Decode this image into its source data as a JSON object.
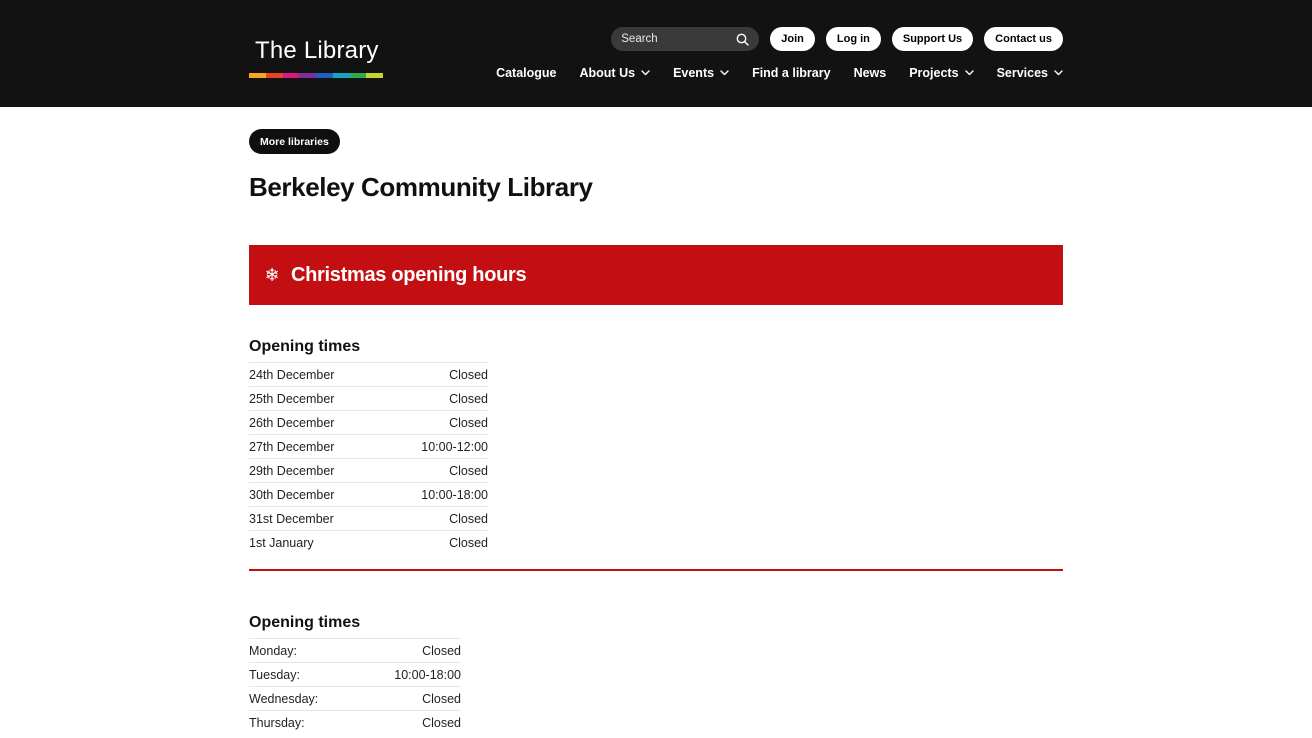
{
  "header": {
    "logo_text": "The Library",
    "logo_colors": [
      "#f5a623",
      "#e8441f",
      "#d9187d",
      "#7b2f9e",
      "#1f5fbf",
      "#17a2c4",
      "#2fa84f",
      "#c9d42a"
    ],
    "search_placeholder": "Search",
    "top_buttons": [
      "Join",
      "Log in",
      "Support Us",
      "Contact us"
    ],
    "nav": [
      {
        "label": "Catalogue",
        "has_dropdown": false
      },
      {
        "label": "About Us",
        "has_dropdown": true
      },
      {
        "label": "Events",
        "has_dropdown": true
      },
      {
        "label": "Find a library",
        "has_dropdown": false
      },
      {
        "label": "News",
        "has_dropdown": false
      },
      {
        "label": "Projects",
        "has_dropdown": true
      },
      {
        "label": "Services",
        "has_dropdown": true
      }
    ]
  },
  "main": {
    "more_button": "More libraries",
    "title": "Berkeley Community Library",
    "banner": {
      "icon": "snowflake-icon",
      "title": "Christmas opening hours",
      "color": "#c40f12"
    },
    "christmas_hours": {
      "heading": "Opening times",
      "rows": [
        {
          "day": "24th December",
          "hours": "Closed"
        },
        {
          "day": "25th December",
          "hours": "Closed"
        },
        {
          "day": "26th December",
          "hours": "Closed"
        },
        {
          "day": "27th December",
          "hours": "10:00-12:00"
        },
        {
          "day": "29th December",
          "hours": "Closed"
        },
        {
          "day": "30th December",
          "hours": "10:00-18:00"
        },
        {
          "day": "31st December",
          "hours": "Closed"
        },
        {
          "day": "1st January",
          "hours": "Closed"
        }
      ]
    },
    "regular_hours": {
      "heading": "Opening times",
      "rows": [
        {
          "day": "Monday:",
          "hours": "Closed"
        },
        {
          "day": "Tuesday:",
          "hours": "10:00-18:00"
        },
        {
          "day": "Wednesday:",
          "hours": "Closed"
        },
        {
          "day": "Thursday:",
          "hours": "Closed"
        }
      ]
    }
  }
}
